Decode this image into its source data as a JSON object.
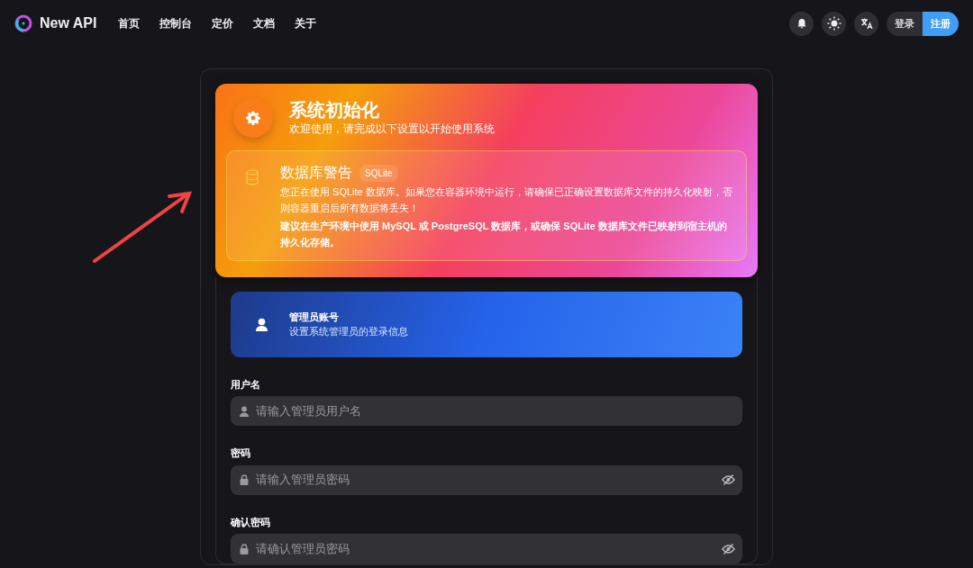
{
  "navbar": {
    "brand": "New API",
    "links": [
      {
        "label": "首页"
      },
      {
        "label": "控制台"
      },
      {
        "label": "定价"
      },
      {
        "label": "文档"
      },
      {
        "label": "关于"
      }
    ],
    "login": "登录",
    "register": "注册"
  },
  "header": {
    "title": "系统初始化",
    "subtitle": "欢迎使用，请完成以下设置以开始使用系统"
  },
  "warning": {
    "title": "数据库警告",
    "tag": "SQLite",
    "message": "您正在使用 SQLite 数据库。如果您在容器环境中运行，请确保已正确设置数据库文件的持久化映射，否则容器重启后所有数据将丢失！",
    "advice": "建议在生产环境中使用 MySQL 或 PostgreSQL 数据库，或确保 SQLite 数据库文件已映射到宿主机的持久化存储。"
  },
  "section": {
    "title": "管理员账号",
    "subtitle": "设置系统管理员的登录信息"
  },
  "fields": [
    {
      "label": "用户名",
      "kind": "text",
      "placeholder": "请输入管理员用户名"
    },
    {
      "label": "密码",
      "kind": "password",
      "placeholder": "请输入管理员密码"
    },
    {
      "label": "确认密码",
      "kind": "password",
      "placeholder": "请确认管理员密码"
    }
  ]
}
